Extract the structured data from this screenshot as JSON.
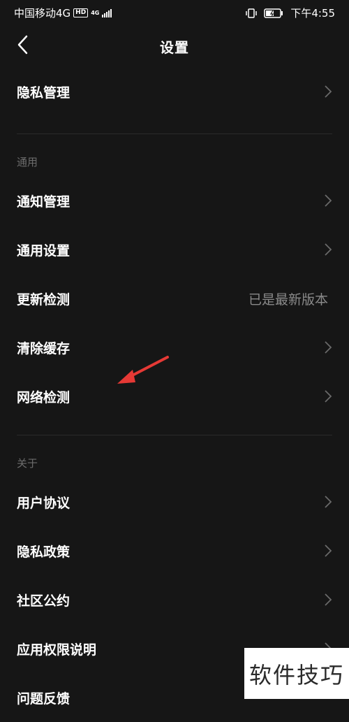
{
  "status_bar": {
    "carrier": "中国移动4G",
    "hd": "HD",
    "net": "4G",
    "time": "下午4:55"
  },
  "header": {
    "title": "设置"
  },
  "top_item": {
    "label": "隐私管理"
  },
  "sections": [
    {
      "title": "通用",
      "items": [
        {
          "label": "通知管理"
        },
        {
          "label": "通用设置"
        },
        {
          "label": "更新检测",
          "value": "已是最新版本"
        },
        {
          "label": "清除缓存"
        },
        {
          "label": "网络检测"
        }
      ]
    },
    {
      "title": "关于",
      "items": [
        {
          "label": "用户协议"
        },
        {
          "label": "隐私政策"
        },
        {
          "label": "社区公约"
        },
        {
          "label": "应用权限说明"
        },
        {
          "label": "问题反馈"
        }
      ]
    }
  ],
  "watermark": "软件技巧",
  "colors": {
    "background": "#161616",
    "annotation_arrow": "#e53935",
    "secondary_text": "#8a8a8a"
  },
  "icons": [
    "back-arrow-icon",
    "chevron-right-icon",
    "vibrate-icon",
    "battery-icon",
    "signal-icon"
  ]
}
